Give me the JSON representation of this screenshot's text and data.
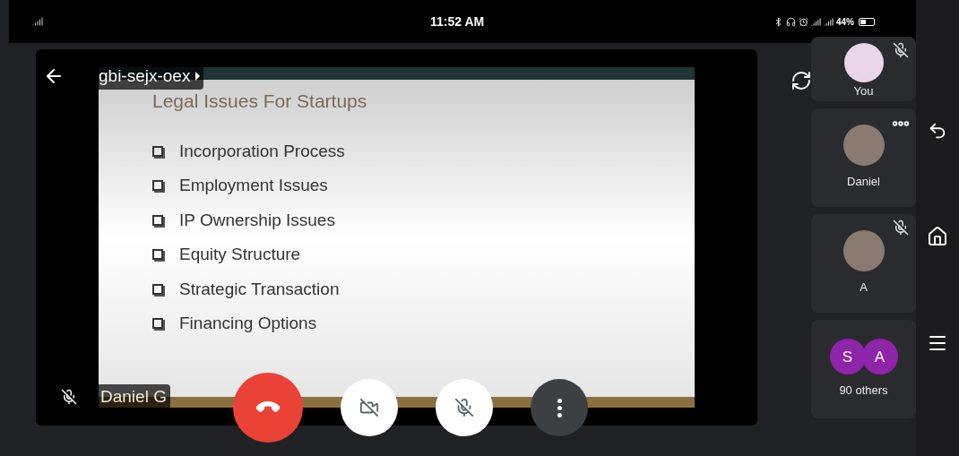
{
  "status_bar": {
    "time": "11:52 AM",
    "battery": "44%"
  },
  "meeting": {
    "code": "gbi-sejx-oex",
    "presenter": {
      "name": "Daniel G",
      "muted": true
    }
  },
  "slide": {
    "title": "Legal Issues For Startups",
    "bullets": [
      "Incorporation Process",
      "Employment Issues",
      "IP Ownership Issues",
      "Equity Structure",
      "Strategic Transaction",
      "Financing Options"
    ]
  },
  "participants": [
    {
      "name": "You",
      "muted": true,
      "menu": false
    },
    {
      "name": "Daniel",
      "muted": false,
      "menu": true
    },
    {
      "name": "A",
      "muted": true,
      "menu": false
    }
  ],
  "others": {
    "avatars": [
      {
        "letter": "S",
        "color": "#8e24aa"
      },
      {
        "letter": "A",
        "color": "#8e24aa"
      }
    ],
    "label": "90 others"
  },
  "controls": {
    "camera_on": false,
    "mic_on": false
  }
}
